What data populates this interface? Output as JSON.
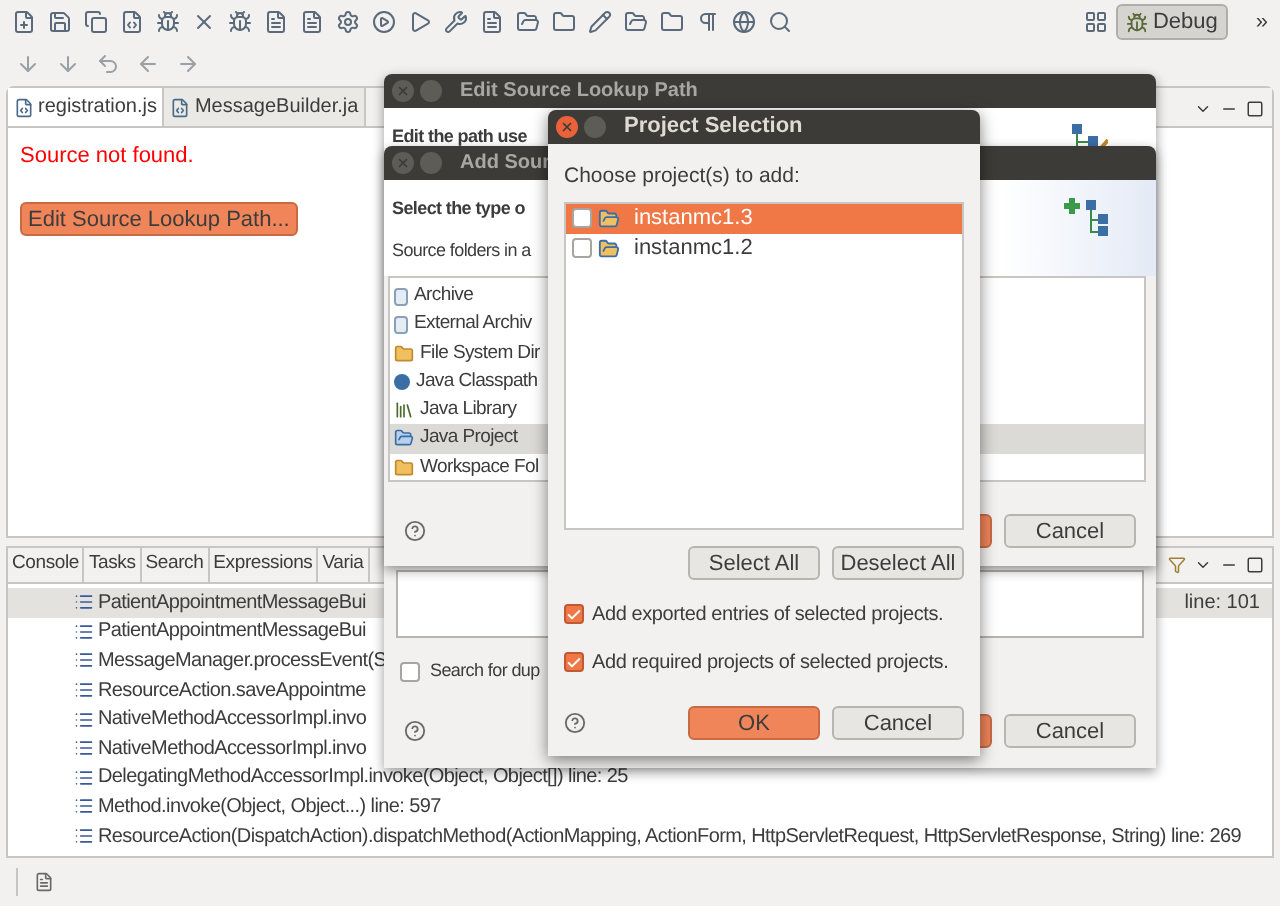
{
  "toolbar": {
    "perspective": {
      "label": "Debug",
      "selected": true
    },
    "overflow": "»"
  },
  "editor": {
    "tabs": [
      {
        "label": "registration.js",
        "selected": true
      },
      {
        "label": "MessageBuilder.ja",
        "selected": false
      }
    ],
    "message": "Source not found.",
    "button": "Edit Source Lookup Path..."
  },
  "bottom_panel": {
    "tabs": [
      {
        "label": "Console",
        "selected": false
      },
      {
        "label": "Tasks",
        "selected": false
      },
      {
        "label": "Search",
        "selected": false
      },
      {
        "label": "Expressions",
        "selected": false
      },
      {
        "label": "Varia",
        "selected": false
      }
    ],
    "rows": [
      {
        "text": "PatientAppointmentMessageBui",
        "suffix": "line: 101",
        "selected": true
      },
      {
        "text": "PatientAppointmentMessageBui",
        "selected": false
      },
      {
        "text": "MessageManager.processEvent(S",
        "selected": false
      },
      {
        "text": "ResourceAction.saveAppointme",
        "selected": false
      },
      {
        "text": "NativeMethodAccessorImpl.invo",
        "selected": false
      },
      {
        "text": "NativeMethodAccessorImpl.invo",
        "selected": false
      },
      {
        "text": "DelegatingMethodAccessorImpl.invoke(Object, Object[]) line: 25",
        "selected": false
      },
      {
        "text": "Method.invoke(Object, Object...) line: 597",
        "selected": false
      },
      {
        "text": "ResourceAction(DispatchAction).dispatchMethod(ActionMapping, ActionForm, HttpServletRequest, HttpServletResponse, String) line: 269",
        "selected": false
      }
    ]
  },
  "edit_dialog": {
    "title": "Edit Source Lookup Path",
    "heading": "Edit the path use",
    "checkbox": {
      "label": "Search for dup",
      "checked": false
    },
    "cancel": "Cancel"
  },
  "add_dialog": {
    "title": "Add Sour",
    "heading": "Select the type o",
    "description": "Source folders in a",
    "items": [
      {
        "label": "Archive",
        "kind": "jar",
        "selected": false
      },
      {
        "label": "External Archiv",
        "kind": "jar",
        "selected": false
      },
      {
        "label": "File System Dir",
        "kind": "folder",
        "selected": false
      },
      {
        "label": "Java Classpath",
        "kind": "dot",
        "selected": false
      },
      {
        "label": "Java Library",
        "kind": "library",
        "selected": false
      },
      {
        "label": "Java Project",
        "kind": "project",
        "selected": true
      },
      {
        "label": "Workspace Fol",
        "kind": "folder",
        "selected": false
      }
    ],
    "cancel": "Cancel"
  },
  "project_dialog": {
    "title": "Project Selection",
    "prompt": "Choose project(s) to add:",
    "projects": [
      {
        "label": "instanmc1.3",
        "checked": false,
        "selected": true
      },
      {
        "label": "instanmc1.2",
        "checked": false,
        "selected": false
      }
    ],
    "select_all": "Select All",
    "deselect_all": "Deselect All",
    "options": [
      {
        "label": "Add exported entries of selected projects.",
        "checked": true
      },
      {
        "label": "Add required projects of selected projects.",
        "checked": true
      }
    ],
    "ok": "OK",
    "cancel": "Cancel"
  }
}
